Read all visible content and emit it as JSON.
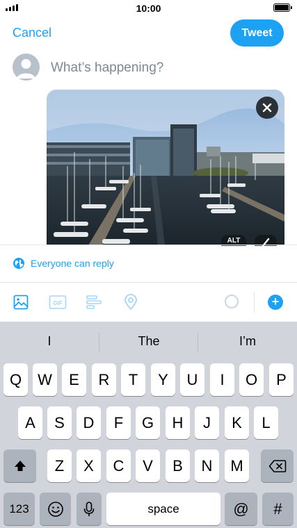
{
  "status_bar": {
    "time": "10:00"
  },
  "header": {
    "cancel_label": "Cancel",
    "tweet_label": "Tweet"
  },
  "compose": {
    "placeholder": "What’s happening?"
  },
  "media": {
    "alt_label": "ALT"
  },
  "reply_setting": {
    "label": "Everyone can reply"
  },
  "toolbar": {
    "items": [
      "image-icon",
      "gif-icon",
      "poll-icon",
      "location-icon"
    ],
    "gif_label": "GIF"
  },
  "keyboard": {
    "suggestions": [
      "I",
      "The",
      "I’m"
    ],
    "rows": [
      [
        "Q",
        "W",
        "E",
        "R",
        "T",
        "Y",
        "U",
        "I",
        "O",
        "P"
      ],
      [
        "A",
        "S",
        "D",
        "F",
        "G",
        "H",
        "J",
        "K",
        "L"
      ],
      [
        "Z",
        "X",
        "C",
        "V",
        "B",
        "N",
        "M"
      ]
    ],
    "numbers_label": "123",
    "space_label": "space",
    "at_label": "@",
    "hash_label": "#"
  },
  "colors": {
    "accent": "#1da1f2",
    "keyboard_bg": "#d1d5db",
    "dark_key": "#acb3bc"
  }
}
